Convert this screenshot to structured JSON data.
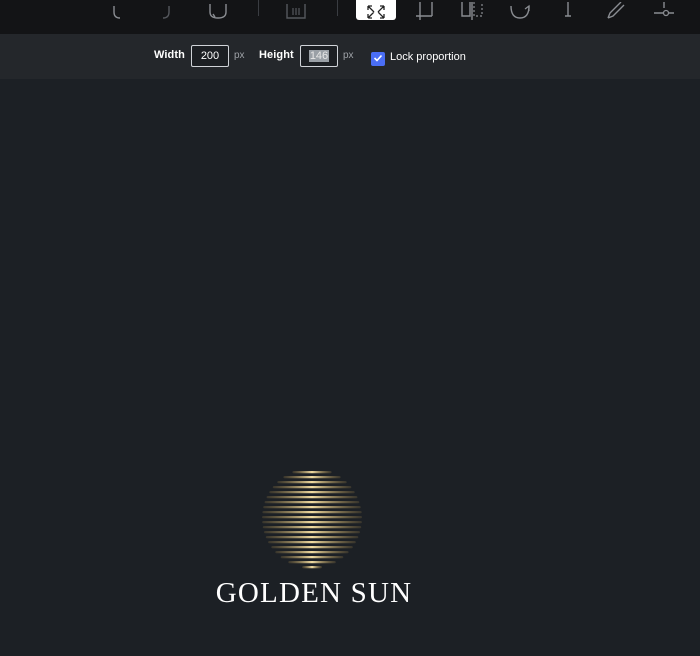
{
  "toolbar": {
    "tools": [
      {
        "name": "undo",
        "icon": "undo-icon"
      },
      {
        "name": "redo",
        "icon": "redo-icon"
      },
      {
        "name": "reset",
        "icon": "reset-icon"
      },
      {
        "name": "delete",
        "icon": "delete-icon"
      },
      {
        "name": "resize",
        "icon": "resize-icon",
        "active": true
      },
      {
        "name": "crop",
        "icon": "crop-icon"
      },
      {
        "name": "flip",
        "icon": "flip-icon"
      },
      {
        "name": "rotate",
        "icon": "rotate-icon"
      },
      {
        "name": "text",
        "icon": "text-icon"
      },
      {
        "name": "draw",
        "icon": "pencil-icon"
      },
      {
        "name": "filter",
        "icon": "adjust-icon"
      }
    ],
    "active_color": "#ffffff",
    "icon_color": "#8a8d92"
  },
  "resize": {
    "width_label": "Width",
    "width_value": "200",
    "width_unit": "px",
    "height_label": "Height",
    "height_value": "146",
    "height_unit": "px",
    "lock_label": "Lock proportion",
    "lock_checked": true,
    "checkbox_color": "#4a6ef5"
  },
  "image": {
    "brand_name": "GOLDEN SUN",
    "sun_colors": [
      "#f3dfa6",
      "#c9a457",
      "#7e6a3a"
    ]
  }
}
